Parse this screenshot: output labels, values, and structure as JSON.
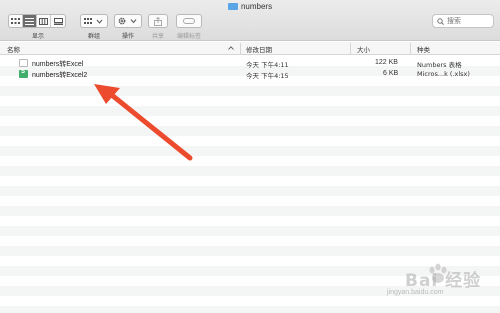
{
  "window": {
    "title": "numbers"
  },
  "toolbar": {
    "view_label": "显示",
    "group_label": "群组",
    "action_label": "操作",
    "share_label": "共享",
    "tag_label": "编辑标签"
  },
  "search": {
    "placeholder": "搜索"
  },
  "columns": {
    "name": "名称",
    "date": "修改日期",
    "size": "大小",
    "kind": "种类"
  },
  "files": [
    {
      "name": "numbers转Excel",
      "date": "今天 下午4:11",
      "size": "122 KB",
      "kind": "Numbers 表格",
      "icon": "numbers-file-icon"
    },
    {
      "name": "numbers转Excel2",
      "date": "今天 下午4:15",
      "size": "6 KB",
      "kind": "Micros...k (.xlsx)",
      "icon": "excel-file-icon"
    }
  ],
  "annotation": {
    "arrow_color": "#ec4b2d"
  },
  "watermark": {
    "brand": "Bai 经验",
    "url": "jingyan.baidu.com"
  }
}
